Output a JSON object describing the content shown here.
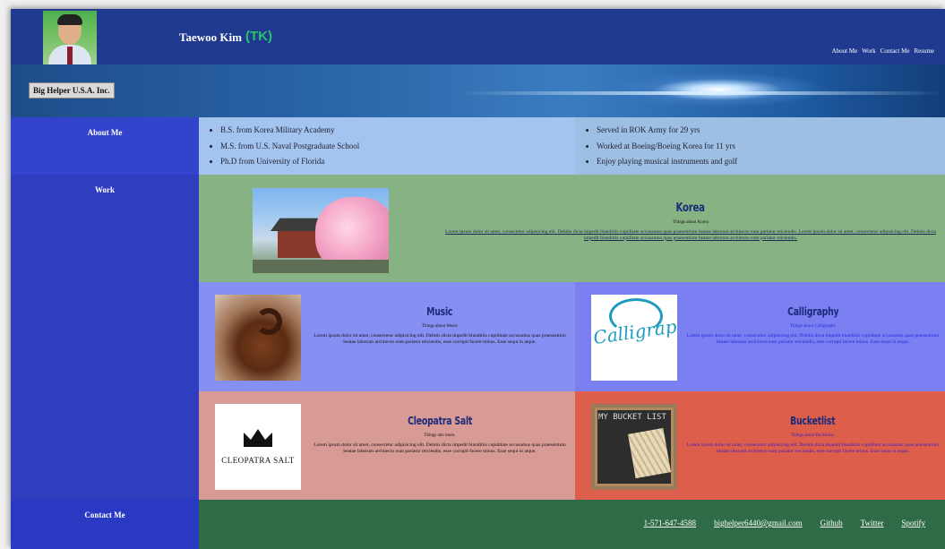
{
  "header": {
    "name": "Taewoo Kim",
    "initials": "(TK)",
    "nav": [
      "About Me",
      "Work",
      "Contact Me",
      "Resume"
    ],
    "company": "Big Helper U.S.A. Inc."
  },
  "sidebar": {
    "about": "About Me",
    "work": "Work",
    "contact": "Contact Me"
  },
  "about": {
    "left": [
      "B.S. from Korea Military Academy",
      "M.S. from U.S. Naval Postgraduate School",
      "Ph.D from University of Florida"
    ],
    "right": [
      "Served in ROK Army for 29 yrs",
      "Worked at Boeing/Boeing Korea for 11 yrs",
      "Enjoy playing musical instruments and golf"
    ]
  },
  "work": {
    "korea": {
      "title": "Korea",
      "sub": "Things about Korea",
      "body": "Lorem ipsum dolor sit amet, consectetur adipisicing elit. Debitis dicta impedit blanditiis cupiditate accusamus quas praesentium beatae laborum architecto eum pariatur reiciendis. Lorem ipsum dolor sit amet, consectetur adipisicing elit. Debitis dicta impedit blanditiis cupiditate accusamus quas praesentium beatae laborum architecto eum pariatur reiciendis."
    },
    "music": {
      "title": "Music",
      "sub": "Things about Music",
      "body": "Lorem ipsum dolor sit amet, consectetur adipisicing elit. Debitis dicta impedit blanditiis cupiditate accusamus quas praesentium beatae laborum architecto eum pariatur reiciendis, esse corrupti facere minus. Esse sequi in atque."
    },
    "calligraphy": {
      "title": "Calligraphy",
      "sub": "Things about Calligraphy",
      "body": "Lorem ipsum dolor sit amet, consectetur adipisicing elit. Debitis dicta impedit blanditiis cupiditate accusamus quas praesentium beatae laborum architecto eum pariatur reiciendis, esse corrupti facere minus. Esse sequi in atque.",
      "logo": "Calligraphy"
    },
    "cleopatra": {
      "title": "Cleopatra Salt",
      "sub": "Things abo more.",
      "body": "Lorem ipsum dolor sit amet, consectetur adipisicing elit. Debitis dicta impedit blanditiis cupiditate accusamus quas praesentium beatae laborum architecto eum pariatur reiciendis, esse corrupti facere minus. Esse sequi in atque.",
      "logo": "CLEOPATRA SALT"
    },
    "bucketlist": {
      "title": "Bucketlist",
      "sub": "Things about Bucketlist.",
      "body": "Lorem ipsum dolor sit amet, consectetur adipisicing elit. Debitis dicta impedit blanditiis cupiditate accusamus quas praesentium beatae laborum architecto eum pariatur reiciendis, esse corrupti facere minus. Esse sequi in atque.",
      "chalk": "MY BUCKET LIST"
    }
  },
  "contact": {
    "links": [
      "1-571-647-4588",
      "bighelper6440@gmail.com",
      "Github",
      "Twitter",
      "Spotify"
    ]
  }
}
